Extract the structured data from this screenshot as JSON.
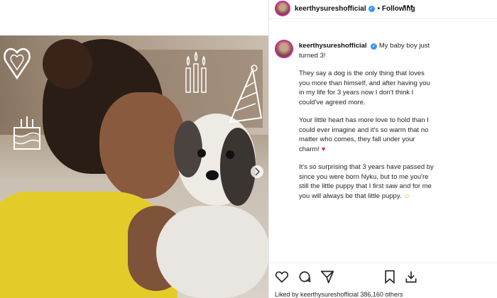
{
  "post": {
    "username": "keerthysureshofficial",
    "follow_status": "Following",
    "more_label": "•••",
    "caption": {
      "line1": "My baby boy just turned 3!",
      "p2": "They say a dog is the only thing that loves you more than himself, and after having you in my life for 3 years now I don't think I could've agreed more.",
      "p3": "Your little heart has more love to hold than I could ever imagine and it's so warm that no matter who comes, they fall under your charm!",
      "p4": "It's so surprising that 3 years have passed by since you were born Nyku, but to me you're still the little puppy that I first saw and for me you will always be that little puppy."
    },
    "likes_text": "Liked by keerthysureshofficial 386,160 others"
  },
  "colors": {
    "accent": "#3897f0",
    "heart": "#e0245e",
    "sweater": "#e3cc2a"
  },
  "icons": [
    "heart-icon",
    "comment-icon",
    "share-icon",
    "bookmark-icon",
    "download-icon",
    "verified-icon"
  ]
}
